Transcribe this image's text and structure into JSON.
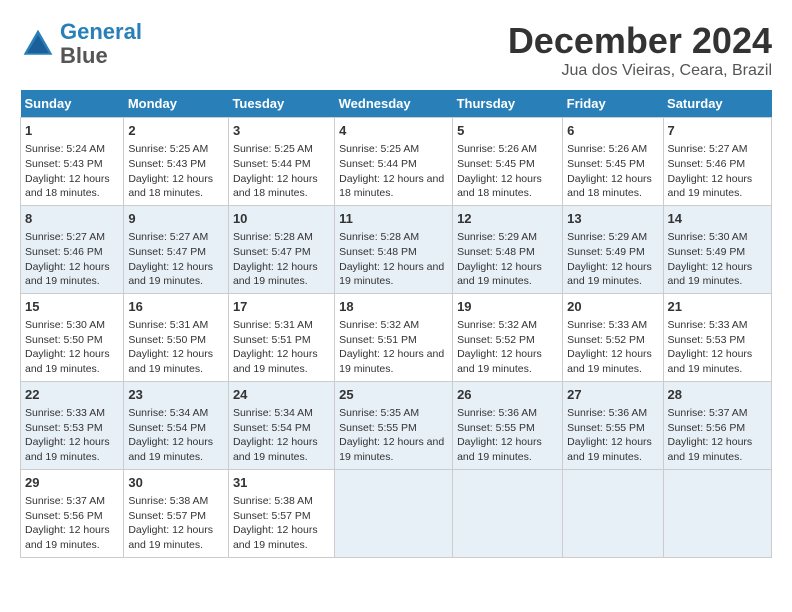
{
  "logo": {
    "line1": "General",
    "line2": "Blue"
  },
  "title": "December 2024",
  "subtitle": "Jua dos Vieiras, Ceara, Brazil",
  "days_of_week": [
    "Sunday",
    "Monday",
    "Tuesday",
    "Wednesday",
    "Thursday",
    "Friday",
    "Saturday"
  ],
  "weeks": [
    [
      {
        "day": "1",
        "sunrise": "5:24 AM",
        "sunset": "5:43 PM",
        "daylight": "12 hours and 18 minutes."
      },
      {
        "day": "2",
        "sunrise": "5:25 AM",
        "sunset": "5:43 PM",
        "daylight": "12 hours and 18 minutes."
      },
      {
        "day": "3",
        "sunrise": "5:25 AM",
        "sunset": "5:44 PM",
        "daylight": "12 hours and 18 minutes."
      },
      {
        "day": "4",
        "sunrise": "5:25 AM",
        "sunset": "5:44 PM",
        "daylight": "12 hours and 18 minutes."
      },
      {
        "day": "5",
        "sunrise": "5:26 AM",
        "sunset": "5:45 PM",
        "daylight": "12 hours and 18 minutes."
      },
      {
        "day": "6",
        "sunrise": "5:26 AM",
        "sunset": "5:45 PM",
        "daylight": "12 hours and 18 minutes."
      },
      {
        "day": "7",
        "sunrise": "5:27 AM",
        "sunset": "5:46 PM",
        "daylight": "12 hours and 19 minutes."
      }
    ],
    [
      {
        "day": "8",
        "sunrise": "5:27 AM",
        "sunset": "5:46 PM",
        "daylight": "12 hours and 19 minutes."
      },
      {
        "day": "9",
        "sunrise": "5:27 AM",
        "sunset": "5:47 PM",
        "daylight": "12 hours and 19 minutes."
      },
      {
        "day": "10",
        "sunrise": "5:28 AM",
        "sunset": "5:47 PM",
        "daylight": "12 hours and 19 minutes."
      },
      {
        "day": "11",
        "sunrise": "5:28 AM",
        "sunset": "5:48 PM",
        "daylight": "12 hours and 19 minutes."
      },
      {
        "day": "12",
        "sunrise": "5:29 AM",
        "sunset": "5:48 PM",
        "daylight": "12 hours and 19 minutes."
      },
      {
        "day": "13",
        "sunrise": "5:29 AM",
        "sunset": "5:49 PM",
        "daylight": "12 hours and 19 minutes."
      },
      {
        "day": "14",
        "sunrise": "5:30 AM",
        "sunset": "5:49 PM",
        "daylight": "12 hours and 19 minutes."
      }
    ],
    [
      {
        "day": "15",
        "sunrise": "5:30 AM",
        "sunset": "5:50 PM",
        "daylight": "12 hours and 19 minutes."
      },
      {
        "day": "16",
        "sunrise": "5:31 AM",
        "sunset": "5:50 PM",
        "daylight": "12 hours and 19 minutes."
      },
      {
        "day": "17",
        "sunrise": "5:31 AM",
        "sunset": "5:51 PM",
        "daylight": "12 hours and 19 minutes."
      },
      {
        "day": "18",
        "sunrise": "5:32 AM",
        "sunset": "5:51 PM",
        "daylight": "12 hours and 19 minutes."
      },
      {
        "day": "19",
        "sunrise": "5:32 AM",
        "sunset": "5:52 PM",
        "daylight": "12 hours and 19 minutes."
      },
      {
        "day": "20",
        "sunrise": "5:33 AM",
        "sunset": "5:52 PM",
        "daylight": "12 hours and 19 minutes."
      },
      {
        "day": "21",
        "sunrise": "5:33 AM",
        "sunset": "5:53 PM",
        "daylight": "12 hours and 19 minutes."
      }
    ],
    [
      {
        "day": "22",
        "sunrise": "5:33 AM",
        "sunset": "5:53 PM",
        "daylight": "12 hours and 19 minutes."
      },
      {
        "day": "23",
        "sunrise": "5:34 AM",
        "sunset": "5:54 PM",
        "daylight": "12 hours and 19 minutes."
      },
      {
        "day": "24",
        "sunrise": "5:34 AM",
        "sunset": "5:54 PM",
        "daylight": "12 hours and 19 minutes."
      },
      {
        "day": "25",
        "sunrise": "5:35 AM",
        "sunset": "5:55 PM",
        "daylight": "12 hours and 19 minutes."
      },
      {
        "day": "26",
        "sunrise": "5:36 AM",
        "sunset": "5:55 PM",
        "daylight": "12 hours and 19 minutes."
      },
      {
        "day": "27",
        "sunrise": "5:36 AM",
        "sunset": "5:55 PM",
        "daylight": "12 hours and 19 minutes."
      },
      {
        "day": "28",
        "sunrise": "5:37 AM",
        "sunset": "5:56 PM",
        "daylight": "12 hours and 19 minutes."
      }
    ],
    [
      {
        "day": "29",
        "sunrise": "5:37 AM",
        "sunset": "5:56 PM",
        "daylight": "12 hours and 19 minutes."
      },
      {
        "day": "30",
        "sunrise": "5:38 AM",
        "sunset": "5:57 PM",
        "daylight": "12 hours and 19 minutes."
      },
      {
        "day": "31",
        "sunrise": "5:38 AM",
        "sunset": "5:57 PM",
        "daylight": "12 hours and 19 minutes."
      },
      null,
      null,
      null,
      null
    ]
  ],
  "cell_labels": {
    "sunrise": "Sunrise:",
    "sunset": "Sunset:",
    "daylight": "Daylight:"
  }
}
